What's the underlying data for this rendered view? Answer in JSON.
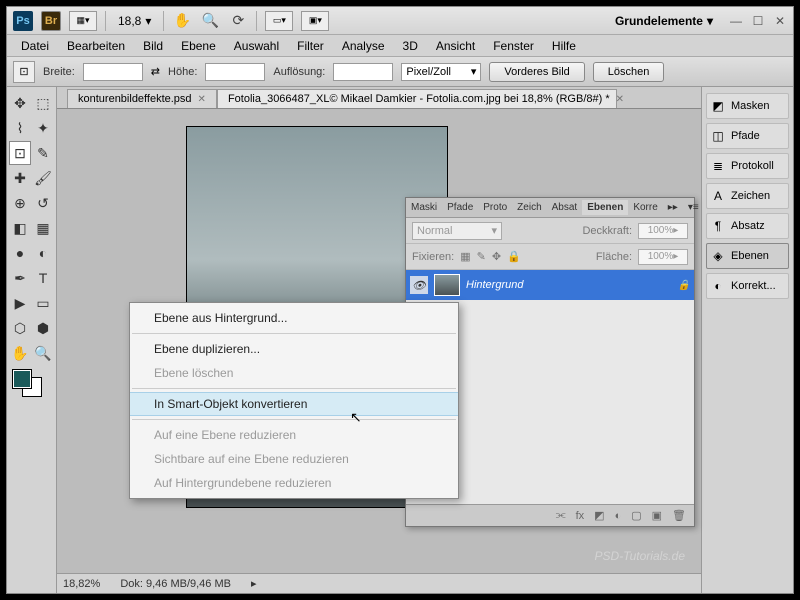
{
  "titlebar": {
    "zoom_pct": "18,8",
    "workspace": "Grundelemente"
  },
  "menu": {
    "datei": "Datei",
    "bearbeiten": "Bearbeiten",
    "bild": "Bild",
    "ebene": "Ebene",
    "auswahl": "Auswahl",
    "filter": "Filter",
    "analyse": "Analyse",
    "dreid": "3D",
    "ansicht": "Ansicht",
    "fenster": "Fenster",
    "hilfe": "Hilfe"
  },
  "optbar": {
    "breite": "Breite:",
    "hoehe": "Höhe:",
    "aufl": "Auflösung:",
    "unit": "Pixel/Zoll",
    "btn1": "Vorderes Bild",
    "btn2": "Löschen"
  },
  "docs": {
    "tab1": "konturenbildeffekte.psd",
    "tab2": "Fotolia_3066487_XL© Mikael Damkier - Fotolia.com.jpg bei 18,8% (RGB/8#) *"
  },
  "status": {
    "zoom": "18,82%",
    "doksize": "Dok: 9,46 MB/9,46 MB"
  },
  "dock": {
    "masken": "Masken",
    "pfade": "Pfade",
    "protokoll": "Protokoll",
    "zeichen": "Zeichen",
    "absatz": "Absatz",
    "ebenen": "Ebenen",
    "korrekt": "Korrekt..."
  },
  "layers_panel": {
    "tabs": [
      "Maski",
      "Pfade",
      "Proto",
      "Zeich",
      "Absat",
      "Ebenen",
      "Korre"
    ],
    "mode": "Normal",
    "opacity_label": "Deckkraft:",
    "opacity": "100%",
    "fix_label": "Fixieren:",
    "fill_label": "Fläche:",
    "fill": "100%",
    "layer_name": "Hintergrund"
  },
  "ctx": {
    "i1": "Ebene aus Hintergrund...",
    "i2": "Ebene duplizieren...",
    "i3": "Ebene löschen",
    "i4": "In Smart-Objekt konvertieren",
    "i5": "Auf eine Ebene reduzieren",
    "i6": "Sichtbare auf eine Ebene reduzieren",
    "i7": "Auf Hintergrundebene reduzieren"
  },
  "watermark": "PSD-Tutorials.de"
}
